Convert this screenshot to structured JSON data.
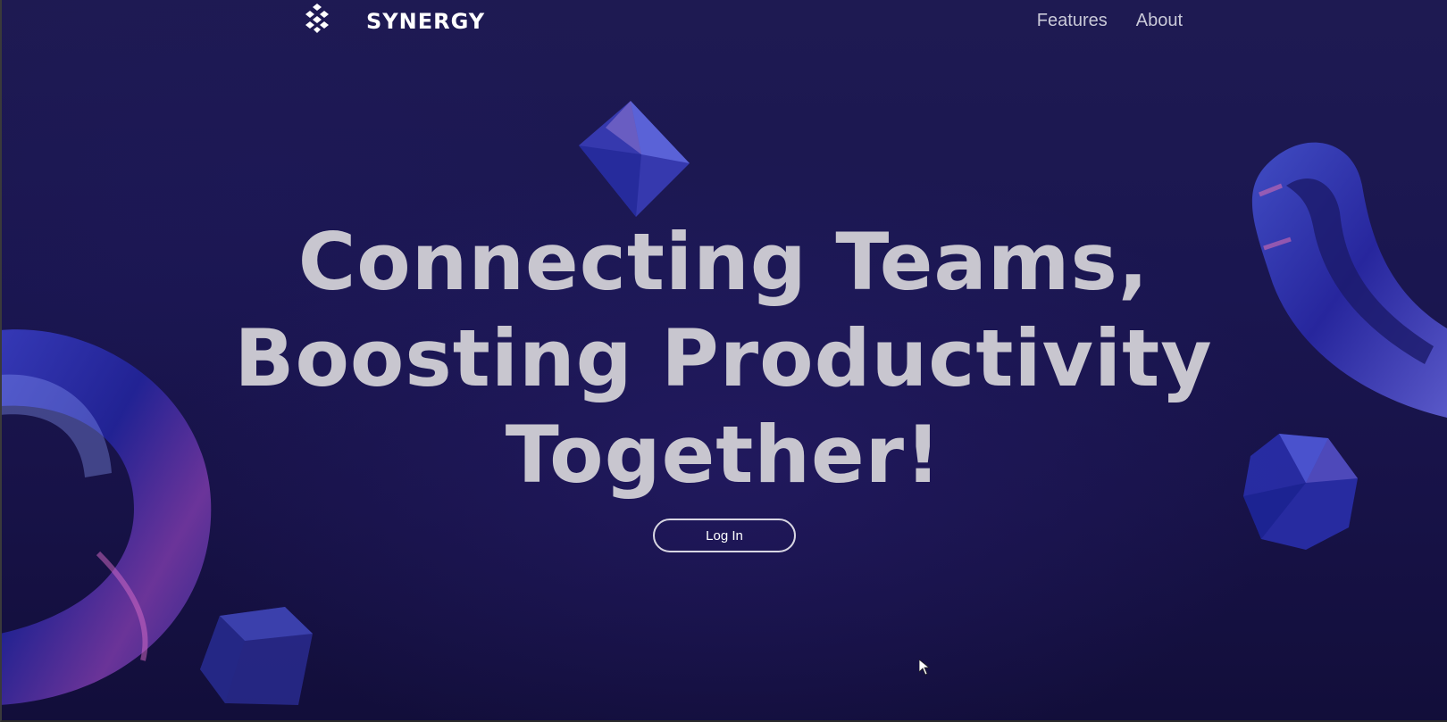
{
  "navbar": {
    "brand": "SYNERGY",
    "logo_icon": "synergy-logo-icon",
    "links": [
      {
        "label": "Features"
      },
      {
        "label": "About"
      }
    ]
  },
  "hero": {
    "headline_lines": [
      "Connecting Teams,",
      "Boosting Productivity",
      "Together!"
    ],
    "login_label": "Log In"
  },
  "colors": {
    "background": "#1b1750",
    "headline": "#c8c6cf",
    "nav_link": "#c9c9d8",
    "button_border": "#d8d6e2"
  }
}
